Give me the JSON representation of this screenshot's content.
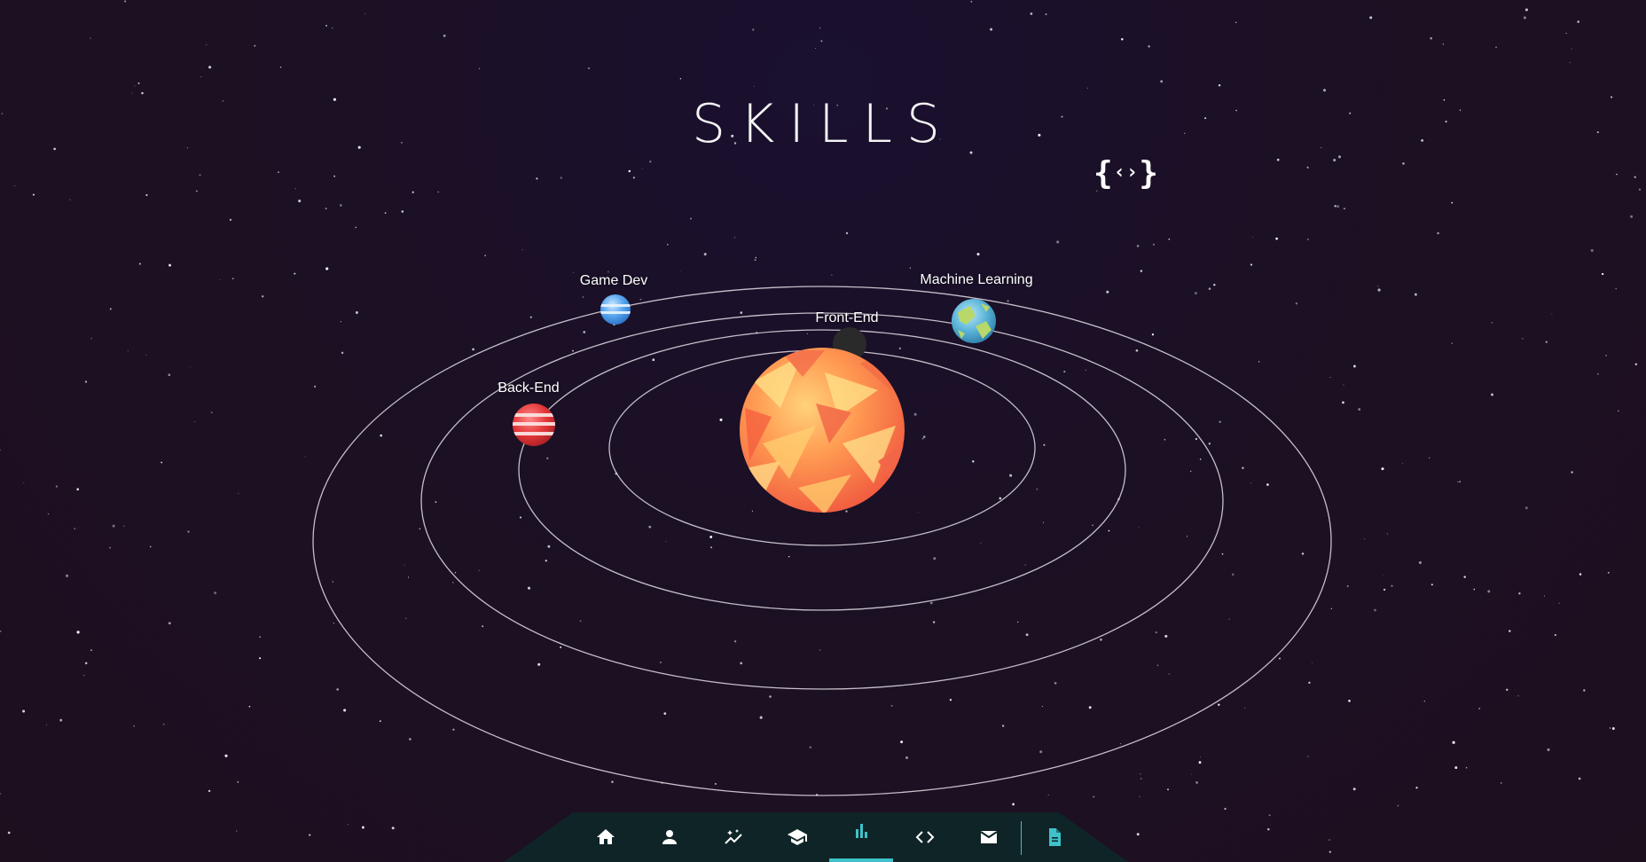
{
  "page": {
    "title": "SKILLS",
    "code_badge": {
      "left": "{",
      "inner": "‹›",
      "right": "}"
    }
  },
  "planets": [
    {
      "name": "Front-End",
      "icon": "sun-planet"
    },
    {
      "name": "Game Dev",
      "icon": "blue-striped-planet"
    },
    {
      "name": "Machine Learning",
      "icon": "earth-planet"
    },
    {
      "name": "Back-End",
      "icon": "red-striped-planet"
    }
  ],
  "nav": {
    "items": [
      {
        "name": "home",
        "icon": "home-icon",
        "active": false
      },
      {
        "name": "about",
        "icon": "person-icon",
        "active": false
      },
      {
        "name": "experience",
        "icon": "sparkle-chart-icon",
        "active": false
      },
      {
        "name": "education",
        "icon": "graduation-cap-icon",
        "active": false
      },
      {
        "name": "skills",
        "icon": "bar-chart-icon",
        "active": true
      },
      {
        "name": "projects",
        "icon": "code-icon",
        "active": false
      },
      {
        "name": "contact",
        "icon": "mail-icon",
        "active": false
      },
      {
        "name": "resume",
        "icon": "document-icon",
        "active": false
      }
    ]
  },
  "colors": {
    "accent": "#3fc1c9",
    "nav_bg": "#0f2426",
    "icon": "#ffffff",
    "orbit": "#d9d2dc"
  }
}
